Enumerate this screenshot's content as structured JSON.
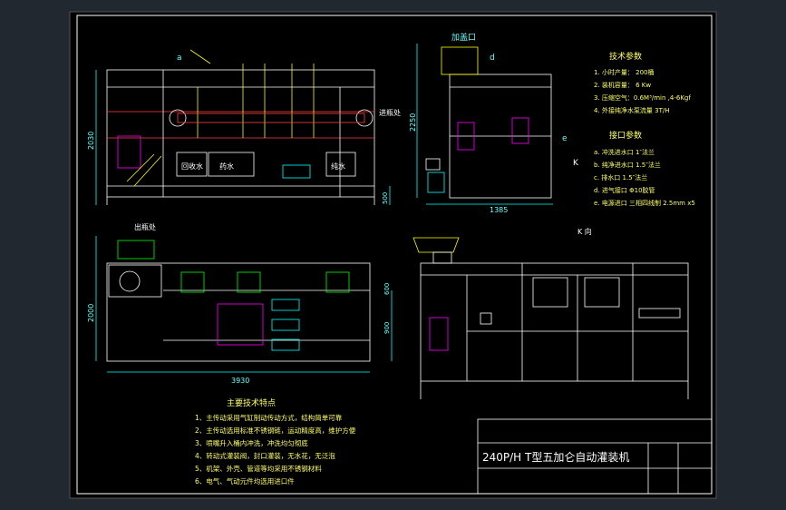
{
  "drawing": {
    "title": "240P/H  T型五加仑自动灌装机",
    "front_view": {
      "labels": {
        "a": "a",
        "inlet_right": "进瓶处",
        "zone1": "回收水",
        "zone2": "药水",
        "zone3": "纯水"
      },
      "dims": {
        "height": "2030",
        "base": "500"
      }
    },
    "side_view": {
      "labels": {
        "cap_feed": "加盖口",
        "d": "d",
        "e": "e",
        "k": "K"
      },
      "dims": {
        "height": "2250",
        "width": "1385"
      }
    },
    "top_view": {
      "labels": {
        "outlet": "出瓶处"
      },
      "dims": {
        "width": "3930",
        "depth": "2000",
        "inner": "900",
        "small": "600"
      }
    },
    "k_view": {
      "label": "K 向"
    },
    "tech_params": {
      "heading": "技术参数",
      "items": [
        "1. 小时产量：  200桶",
        "2. 装机容量：  6 Kw",
        "3. 压缩空气：0.6M³/min ,4-6Kgf",
        "4. 外接纯净水泵流量 3T/H"
      ]
    },
    "interface_params": {
      "heading": "接口参数",
      "items": [
        "a. 冲洗进水口   1″法兰",
        "b. 纯净进水口   1.5″法兰",
        "c. 排水口       1.5″法兰",
        "d. 进气接口     Φ10胶管",
        "e. 电源进口     三相四线制 2.5mm x5"
      ]
    },
    "features": {
      "heading": "主要技术特点",
      "items": [
        "1、主传动采用气缸制动传动方式，结构简单可靠",
        "2、主传动选用标准不锈钢链，运动精度高，维护方便",
        "3、喷嘴升入桶内冲洗，冲洗均匀彻底",
        "4、转动式灌装阀，封口灌装，无水花，无泛泡",
        "5、机架、外壳、管道等均采用不锈钢材料",
        "6、电气、气动元件均选用进口件"
      ]
    }
  }
}
